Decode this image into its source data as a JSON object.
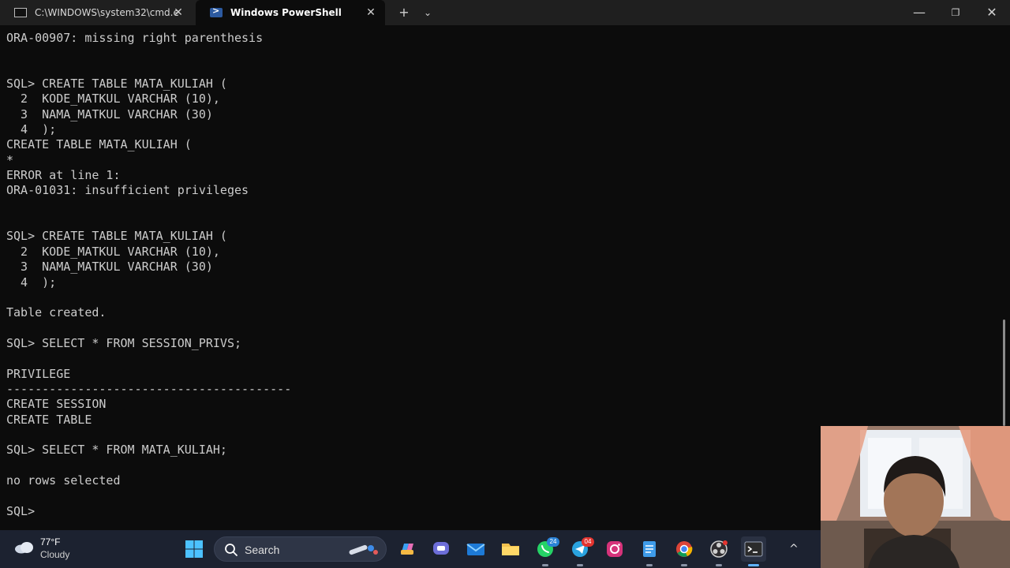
{
  "tabs": [
    {
      "title": "C:\\WINDOWS\\system32\\cmd.e"
    },
    {
      "title": "Windows PowerShell"
    }
  ],
  "titlebar": {
    "new_tab": "+",
    "dropdown": "⌄",
    "minimize": "—",
    "maximize": "❐",
    "close": "✕",
    "tab_close": "✕"
  },
  "terminal": {
    "lines": [
      "ORA-00907: missing right parenthesis",
      "",
      "",
      "SQL> CREATE TABLE MATA_KULIAH (",
      "  2  KODE_MATKUL VARCHAR (10),",
      "  3  NAMA_MATKUL VARCHAR (30)",
      "  4  );",
      "CREATE TABLE MATA_KULIAH (",
      "*",
      "ERROR at line 1:",
      "ORA-01031: insufficient privileges",
      "",
      "",
      "SQL> CREATE TABLE MATA_KULIAH (",
      "  2  KODE_MATKUL VARCHAR (10),",
      "  3  NAMA_MATKUL VARCHAR (30)",
      "  4  );",
      "",
      "Table created.",
      "",
      "SQL> SELECT * FROM SESSION_PRIVS;",
      "",
      "PRIVILEGE",
      "----------------------------------------",
      "CREATE SESSION",
      "CREATE TABLE",
      "",
      "SQL> SELECT * FROM MATA_KULIAH;",
      "",
      "no rows selected",
      "",
      "SQL> "
    ]
  },
  "taskbar": {
    "weather": {
      "temp": "77°F",
      "condition": "Cloudy",
      "icon": "cloud-icon"
    },
    "search_label": "Search",
    "apps": [
      {
        "name": "copilot",
        "icon": "copilot-icon"
      },
      {
        "name": "teams",
        "icon": "teams-icon"
      },
      {
        "name": "mail",
        "icon": "mail-icon"
      },
      {
        "name": "file-explorer",
        "icon": "folder-icon"
      },
      {
        "name": "whatsapp",
        "icon": "whatsapp-icon",
        "badge": "24"
      },
      {
        "name": "telegram",
        "icon": "telegram-icon",
        "badge": "04"
      },
      {
        "name": "instagram",
        "icon": "instagram-icon"
      },
      {
        "name": "notepad",
        "icon": "notepad-icon"
      },
      {
        "name": "chrome",
        "icon": "chrome-icon"
      },
      {
        "name": "obs",
        "icon": "obs-icon"
      },
      {
        "name": "terminal",
        "icon": "terminal-icon"
      }
    ],
    "tray_chevron": "^"
  },
  "colors": {
    "terminal_bg": "#0c0c0c",
    "terminal_fg": "#cccccc",
    "taskbar_bg": "#1c2230",
    "accent": "#5fb2ff"
  }
}
